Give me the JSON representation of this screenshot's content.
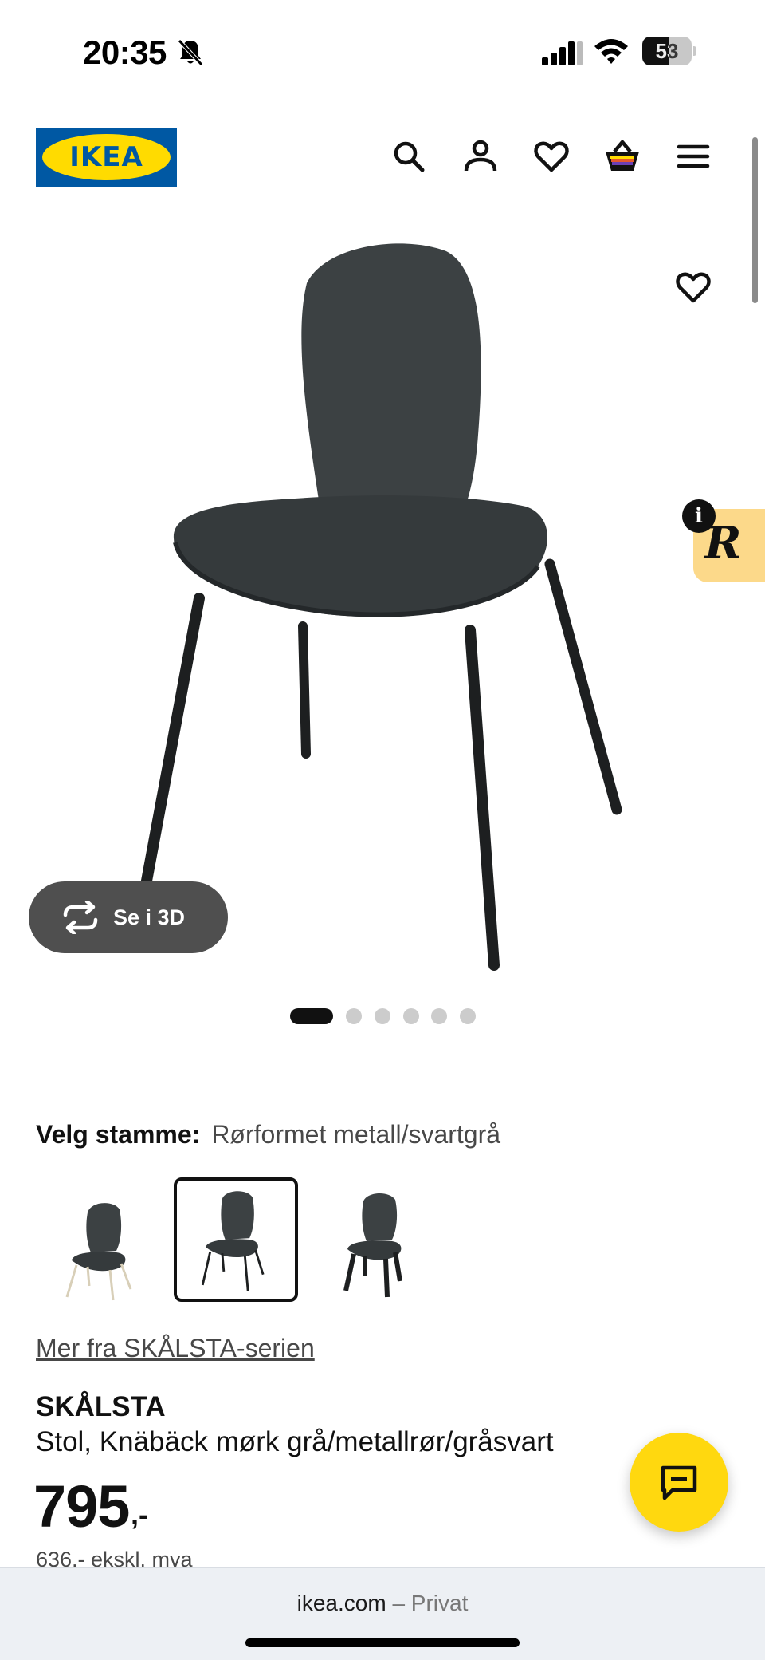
{
  "status_bar": {
    "time": "20:35",
    "battery": "53",
    "battery_level": 0.53
  },
  "header": {
    "logo_text": "IKEA",
    "icons": [
      "search-icon",
      "profile-icon",
      "heart-icon",
      "basket-icon",
      "menu-icon"
    ]
  },
  "gallery": {
    "view_3d_label": "Se i 3D",
    "dot_count": 6,
    "active_dot": 0
  },
  "variant": {
    "label": "Velg stamme:",
    "value": "Rørformet metall/svartgrå",
    "selected_index": 1,
    "options": [
      "metal-legs-light",
      "metal-legs-black",
      "wood-legs-black"
    ]
  },
  "series_link": "Mer fra SKÅLSTA-serien",
  "product": {
    "name": "SKÅLSTA",
    "description": "Stol, Knäbäck mørk grå/metallrør/gråsvart",
    "price": "795",
    "price_suffix": ",-",
    "price_ex_vat": "636,- ekskl. mva"
  },
  "browser": {
    "domain": "ikea.com",
    "separator": "–",
    "mode": "Privat"
  },
  "colors": {
    "ikea_blue": "#0058a3",
    "ikea_yellow": "#ffdb00",
    "chat_yellow": "#ffd80f",
    "widget_bg": "#fcd98a"
  }
}
